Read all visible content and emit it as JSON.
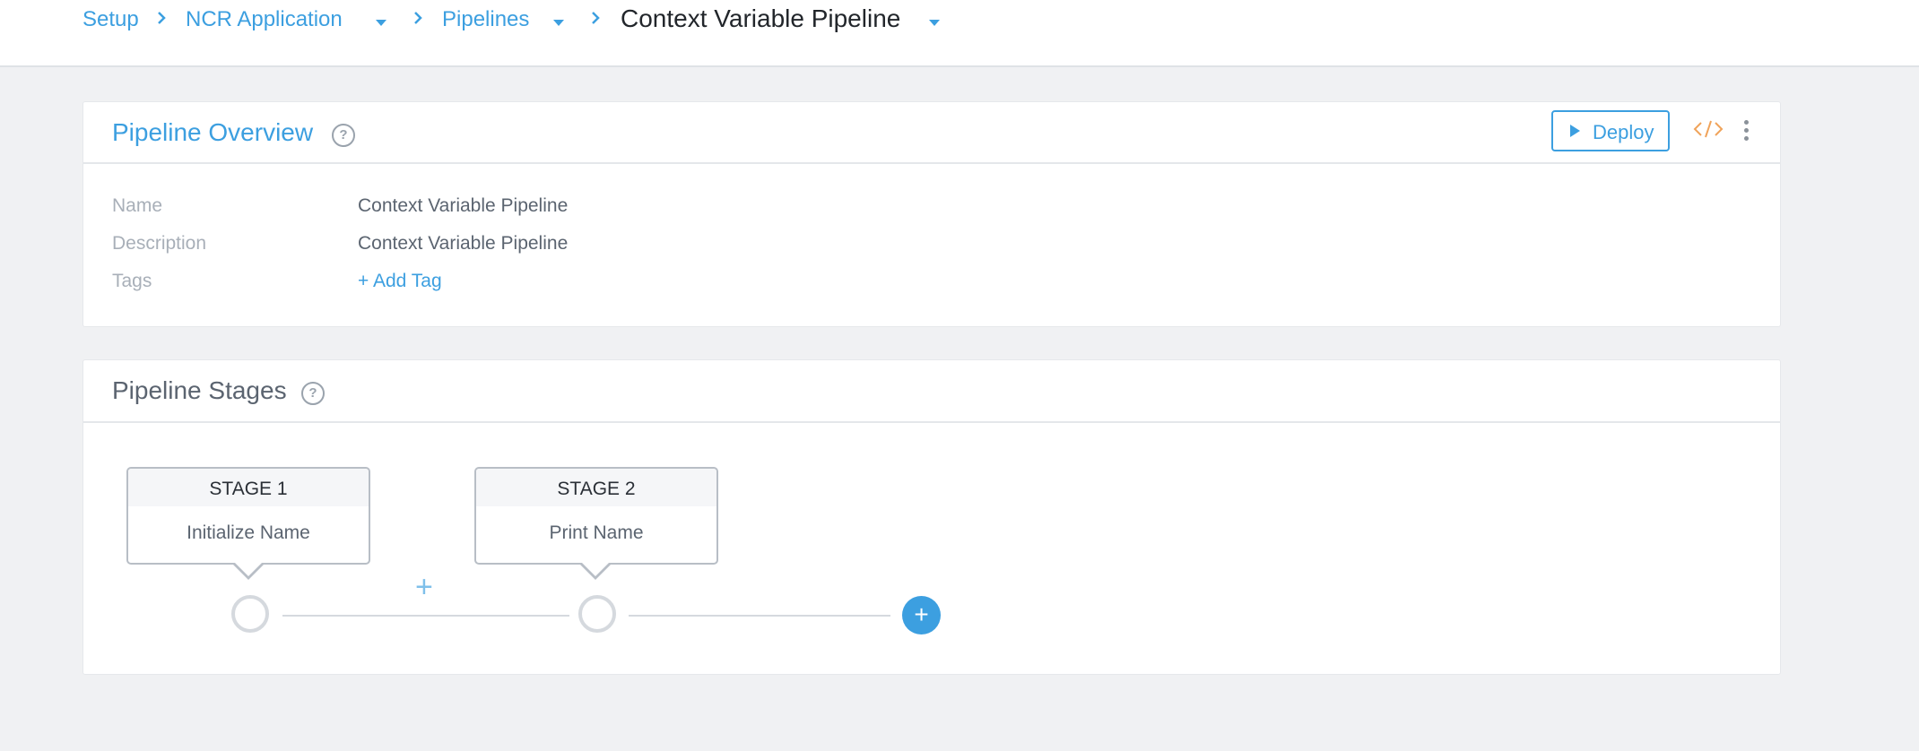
{
  "breadcrumb": {
    "items": [
      {
        "label": "Setup"
      },
      {
        "label": "NCR Application"
      },
      {
        "label": "Pipelines"
      },
      {
        "label": "Context Variable Pipeline"
      }
    ]
  },
  "overview": {
    "title": "Pipeline Overview",
    "help_glyph": "?",
    "deploy_label": "Deploy",
    "fields": {
      "name_label": "Name",
      "name_value": "Context Variable Pipeline",
      "description_label": "Description",
      "description_value": "Context Variable Pipeline",
      "tags_label": "Tags",
      "add_tag_label": "+ Add Tag"
    }
  },
  "stages": {
    "title": "Pipeline Stages",
    "help_glyph": "?",
    "items": [
      {
        "header": "STAGE 1",
        "name": "Initialize Name"
      },
      {
        "header": "STAGE 2",
        "name": "Print Name"
      }
    ],
    "insert_glyph": "+",
    "add_glyph": "+"
  },
  "colors": {
    "accent": "#3c9fe0",
    "code_icon": "#f0a35a",
    "background": "#f0f1f3"
  },
  "icons": [
    "chevron-right-icon",
    "caret-down-icon",
    "help-icon",
    "play-icon",
    "code-icon",
    "more-vertical-icon",
    "plus-icon"
  ]
}
